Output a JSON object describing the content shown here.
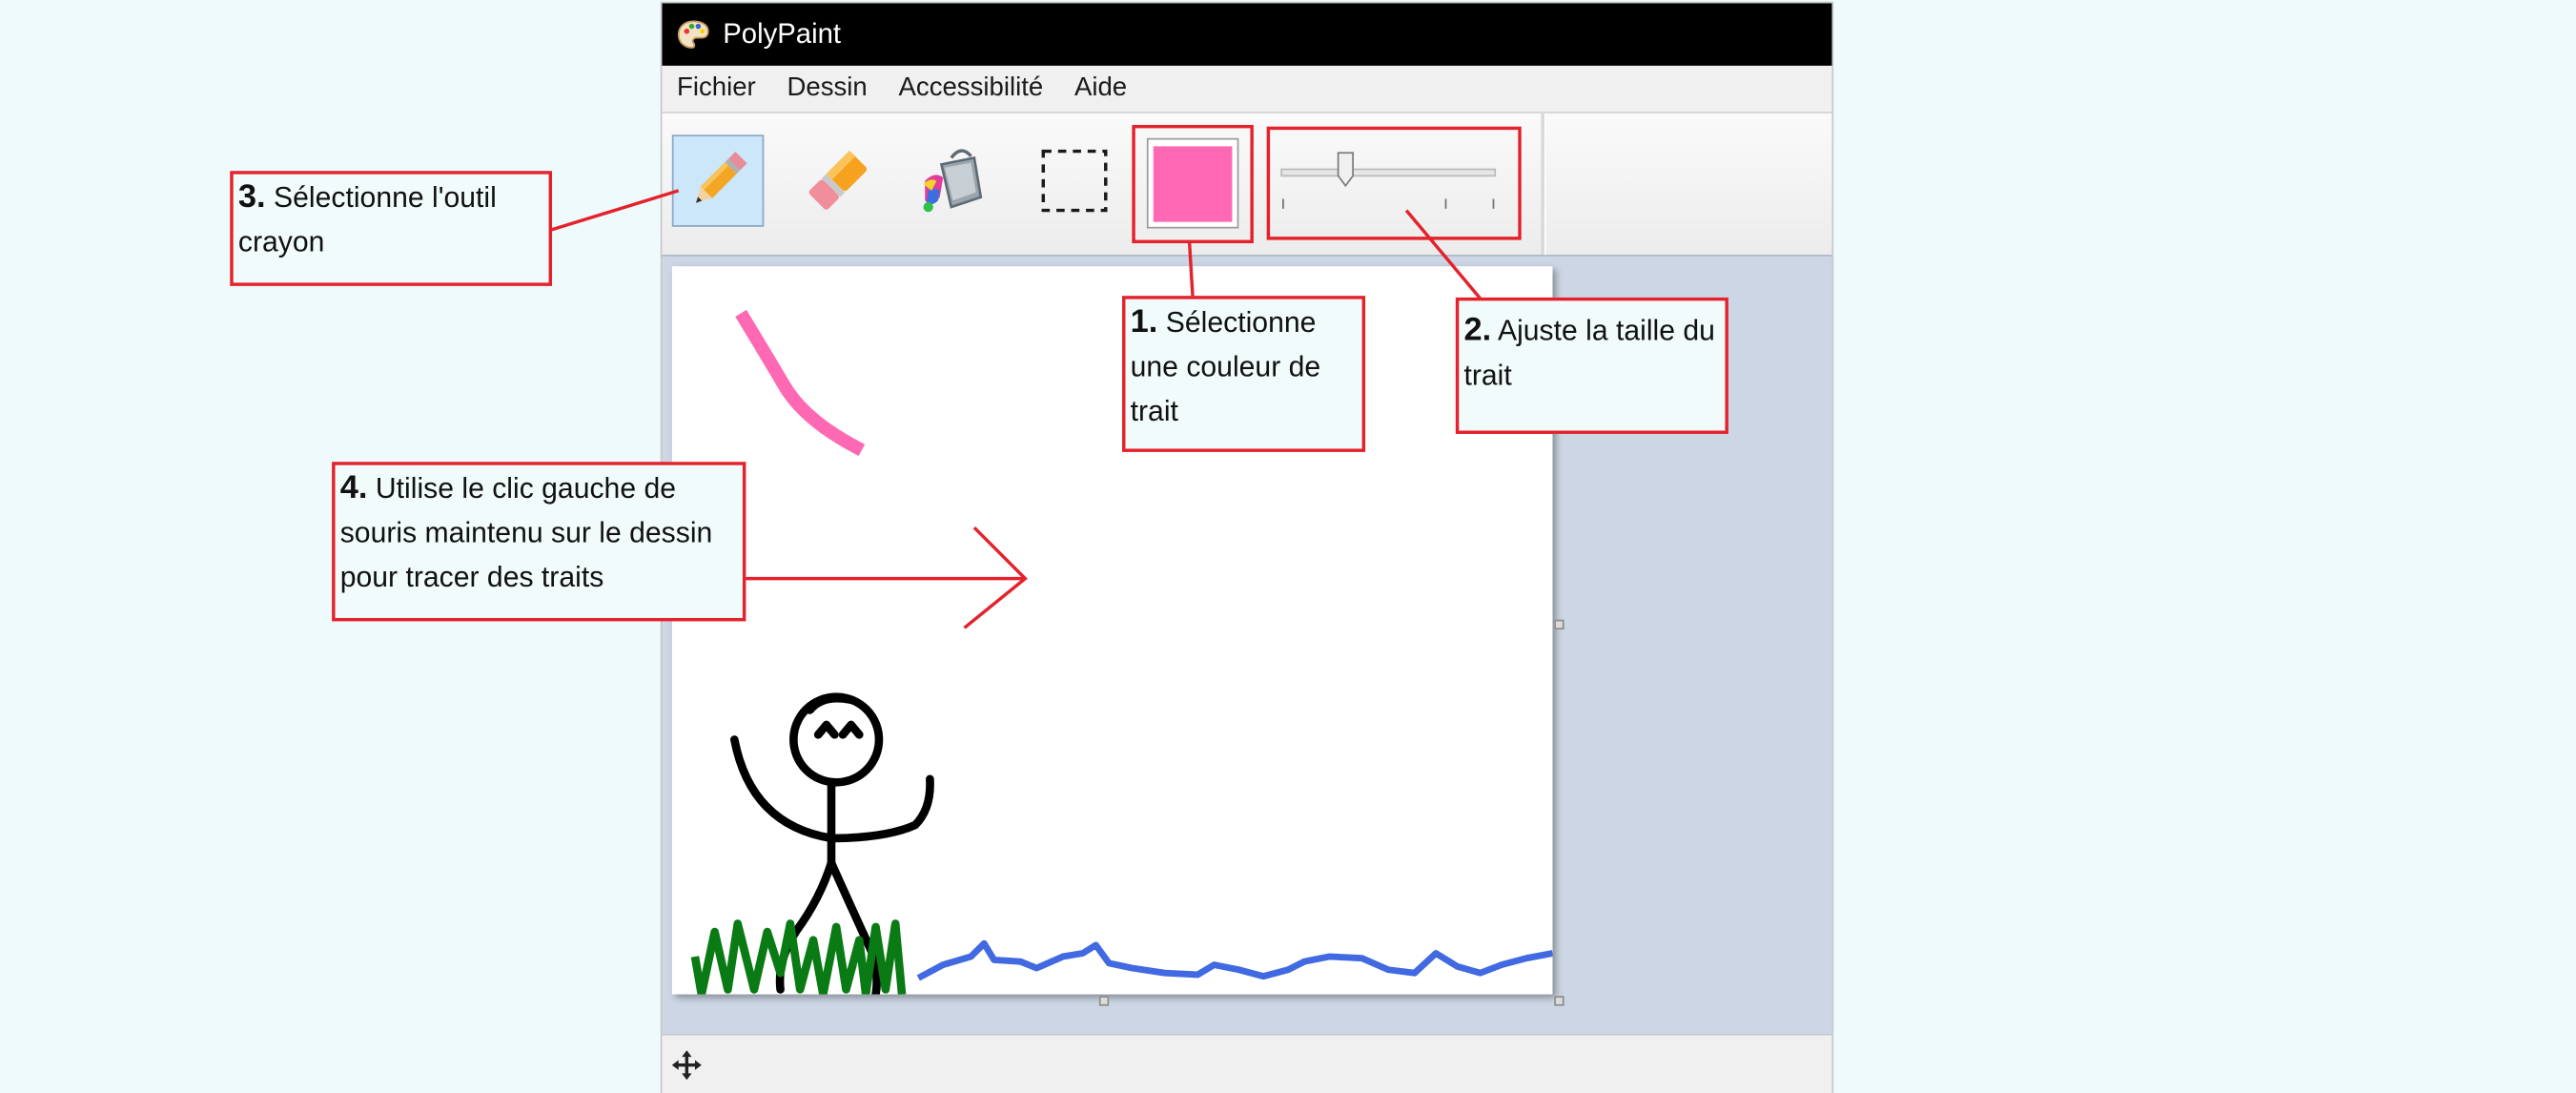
{
  "app": {
    "title": "PolyPaint",
    "icon": "palette-icon"
  },
  "menu": [
    "Fichier",
    "Dessin",
    "Accessibilité",
    "Aide"
  ],
  "toolbar": {
    "tools": [
      {
        "name": "pencil-tool",
        "icon": "pencil-icon",
        "selected": true
      },
      {
        "name": "eraser-tool",
        "icon": "eraser-icon",
        "selected": false
      },
      {
        "name": "fill-tool",
        "icon": "paint-bucket-icon",
        "selected": false
      },
      {
        "name": "selection-tool",
        "icon": "dashed-rectangle-icon",
        "selected": false
      }
    ],
    "stroke_color": "#ff69b4",
    "stroke_size": {
      "value": 0.3
    }
  },
  "drawing": {
    "colors": {
      "pink": "#ff69b4",
      "black": "#000000",
      "green": "#0a7a14",
      "blue": "#4169e1"
    }
  },
  "annotations": {
    "step1": {
      "num": "1.",
      "text": "Sélectionne une couleur de trait"
    },
    "step2": {
      "num": "2.",
      "text": "Ajuste la taille du trait"
    },
    "step3": {
      "num": "3.",
      "text": "Sélectionne l'outil crayon"
    },
    "step4": {
      "num": "4.",
      "text": "Utilise le clic gauche de souris maintenu sur le dessin pour tracer des traits"
    },
    "color": "#e4222c"
  },
  "status": {
    "icon": "move-icon"
  }
}
